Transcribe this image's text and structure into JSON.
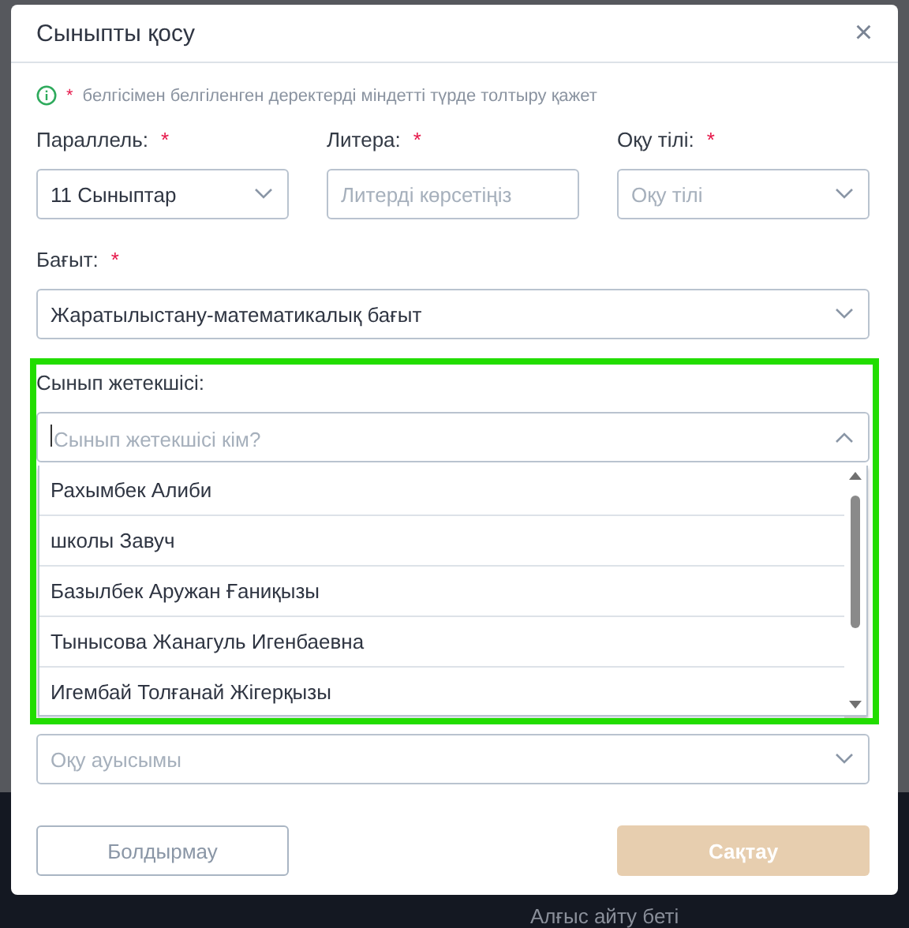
{
  "dialog": {
    "title": "Сыныпты қосу",
    "close": "×"
  },
  "notice": {
    "mark": "*",
    "text": "белгісімен белгіленген деректерді міндетті түрде толтыру қажет"
  },
  "row_fields": [
    {
      "label": "Параллель:",
      "required": true,
      "kind": "select",
      "value": "11 Сыныптар"
    },
    {
      "label": "Литера:",
      "required": true,
      "kind": "input",
      "placeholder": "Литерді көрсетіңіз"
    },
    {
      "label": "Оқу тілі:",
      "required": true,
      "kind": "select",
      "placeholder": "Оқу тілі"
    }
  ],
  "direction": {
    "label": "Бағыт:",
    "required": true,
    "value": "Жаратылыстану-математикалық бағыт"
  },
  "teacher": {
    "label": "Сынып жетекшісі:",
    "required": false,
    "placeholder": "Сынып жетекшісі кім?",
    "expanded": true,
    "highlighted": true,
    "options": [
      "Рахымбек Алиби",
      "школы Завуч",
      "Базылбек Аружан Ғаниқызы",
      "Тынысова Жанагуль Игенбаевна",
      "Игембай Толғанай Жігерқызы"
    ]
  },
  "shift": {
    "placeholder": "Оқу ауысымы"
  },
  "buttons": [
    {
      "label": "Болдырмау",
      "kind": "secondary",
      "disabled": false
    },
    {
      "label": "Сақтау",
      "kind": "primary",
      "disabled": true
    }
  ],
  "background": {
    "text": "Алғыс айту беті"
  }
}
